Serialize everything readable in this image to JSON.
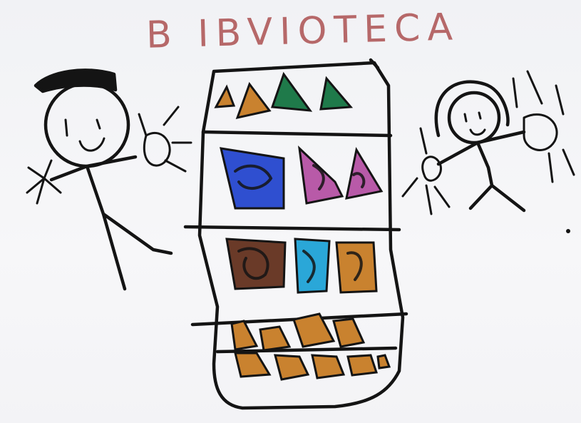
{
  "title": "B IBVIOTECA",
  "colors": {
    "title_ink": "#b05a5a",
    "ink": "#141414",
    "paper": "#f4f4f6",
    "orange": "#c9822f",
    "green": "#1f7a4a",
    "blue": "#2f4fd0",
    "pink": "#b85aa8",
    "brown": "#6a3a28",
    "cyan": "#2aa7d8"
  },
  "figures": [
    {
      "name": "left-person"
    },
    {
      "name": "right-person"
    }
  ],
  "bookshelf": {
    "shelves": 5,
    "book_colors_by_shelf": [
      [
        "orange",
        "orange",
        "green",
        "green"
      ],
      [
        "blue",
        "pink",
        "pink"
      ],
      [
        "brown",
        "cyan",
        "orange"
      ],
      [
        "orange",
        "orange",
        "orange",
        "orange"
      ],
      [
        "orange",
        "orange",
        "orange",
        "orange",
        "orange"
      ]
    ]
  }
}
